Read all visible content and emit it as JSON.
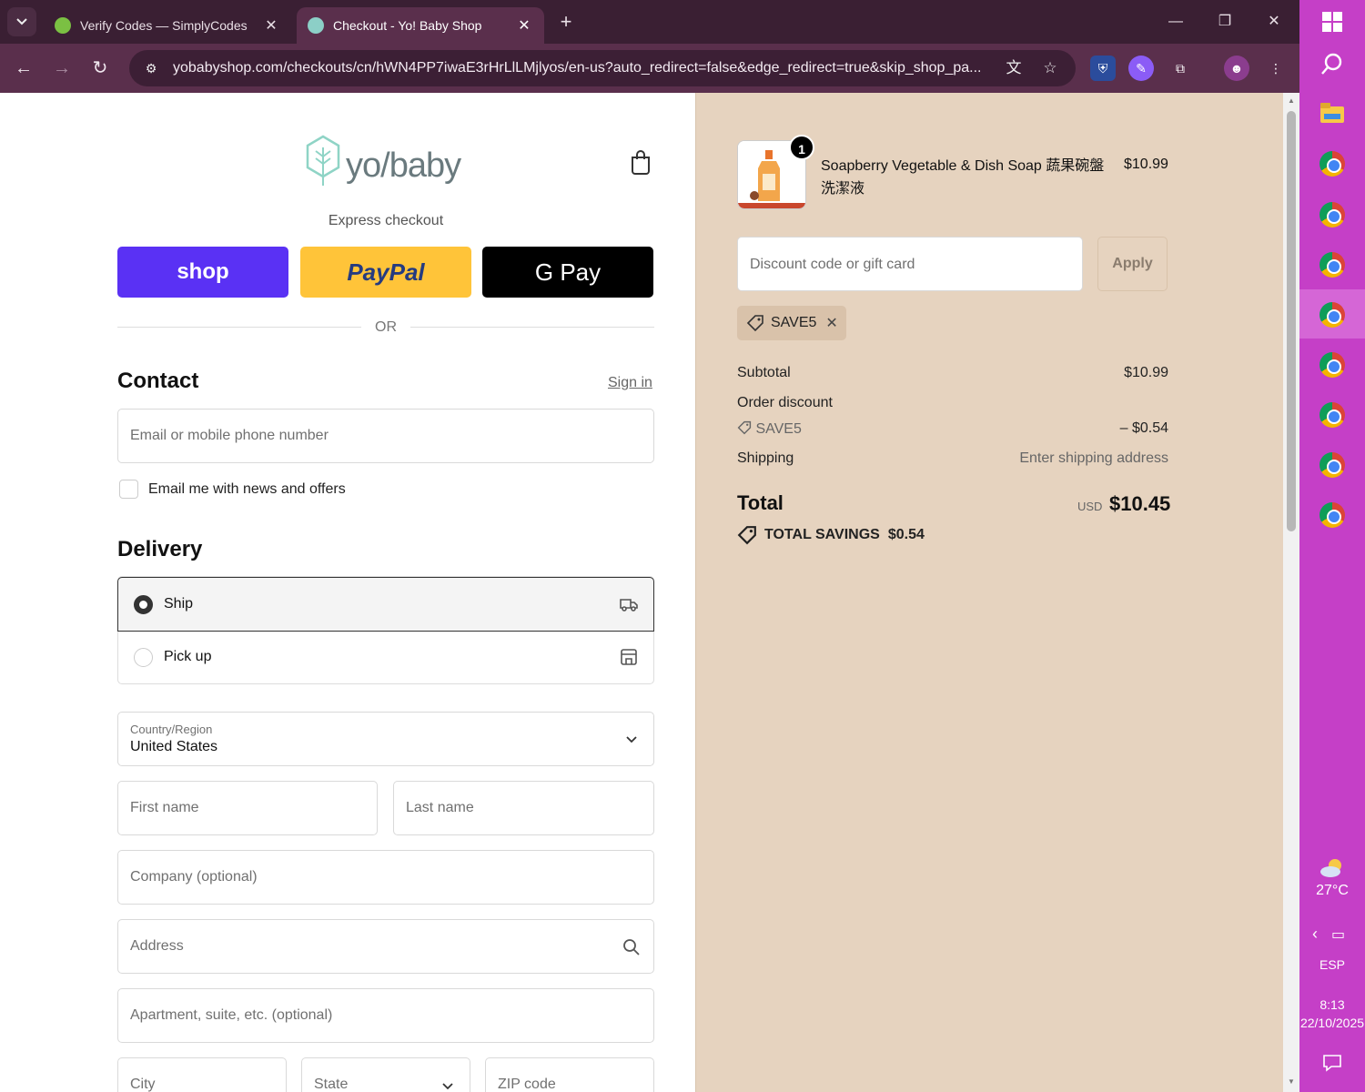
{
  "browser": {
    "tabs": [
      {
        "title": "Verify Codes — SimplyCodes",
        "active": false
      },
      {
        "title": "Checkout - Yo! Baby Shop",
        "active": true
      }
    ],
    "url": "yobabyshop.com/checkouts/cn/hWN4PP7iwaE3rHrLlLMjlyos/en-us?auto_redirect=false&edge_redirect=true&skip_shop_pa..."
  },
  "checkout": {
    "logo_text": "yo/baby",
    "express_label": "Express checkout",
    "express_buttons": {
      "shop": "shop",
      "paypal": "PayPal",
      "gpay": "G Pay"
    },
    "or_label": "OR",
    "contact": {
      "heading": "Contact",
      "sign_in": "Sign in",
      "email_placeholder": "Email or mobile phone number",
      "newsletter_label": "Email me with news and offers",
      "newsletter_checked": false
    },
    "delivery": {
      "heading": "Delivery",
      "options": [
        {
          "label": "Ship",
          "selected": true,
          "icon": "truck-icon"
        },
        {
          "label": "Pick up",
          "selected": false,
          "icon": "store-icon"
        }
      ],
      "country_label": "Country/Region",
      "country_value": "United States",
      "first_name_placeholder": "First name",
      "last_name_placeholder": "Last name",
      "company_placeholder": "Company (optional)",
      "address_placeholder": "Address",
      "apartment_placeholder": "Apartment, suite, etc. (optional)",
      "city_placeholder": "City",
      "state_placeholder": "State",
      "zip_placeholder": "ZIP code"
    }
  },
  "summary": {
    "product": {
      "name": "Soapberry Vegetable & Dish Soap 蔬果碗盤洗潔液",
      "price": "$10.99",
      "quantity": "1"
    },
    "discount_placeholder": "Discount code or gift card",
    "apply_label": "Apply",
    "applied_code": "SAVE5",
    "subtotal_label": "Subtotal",
    "subtotal_value": "$10.99",
    "order_discount_label": "Order discount",
    "discount_code": "SAVE5",
    "discount_value": "– $0.54",
    "shipping_label": "Shipping",
    "shipping_value": "Enter shipping address",
    "total_label": "Total",
    "currency": "USD",
    "total_value": "$10.45",
    "savings_label": "TOTAL SAVINGS",
    "savings_value": "$0.54"
  },
  "taskbar": {
    "weather": "27°C",
    "language": "ESP",
    "time": "8:13",
    "date": "22/10/2025"
  },
  "colors": {
    "shop": "#5a31f4",
    "paypal": "#ffc439",
    "summary_bg": "#e6d3bf",
    "taskbar": "#c53fc7",
    "chrome_frame": "#5a2f4c"
  }
}
